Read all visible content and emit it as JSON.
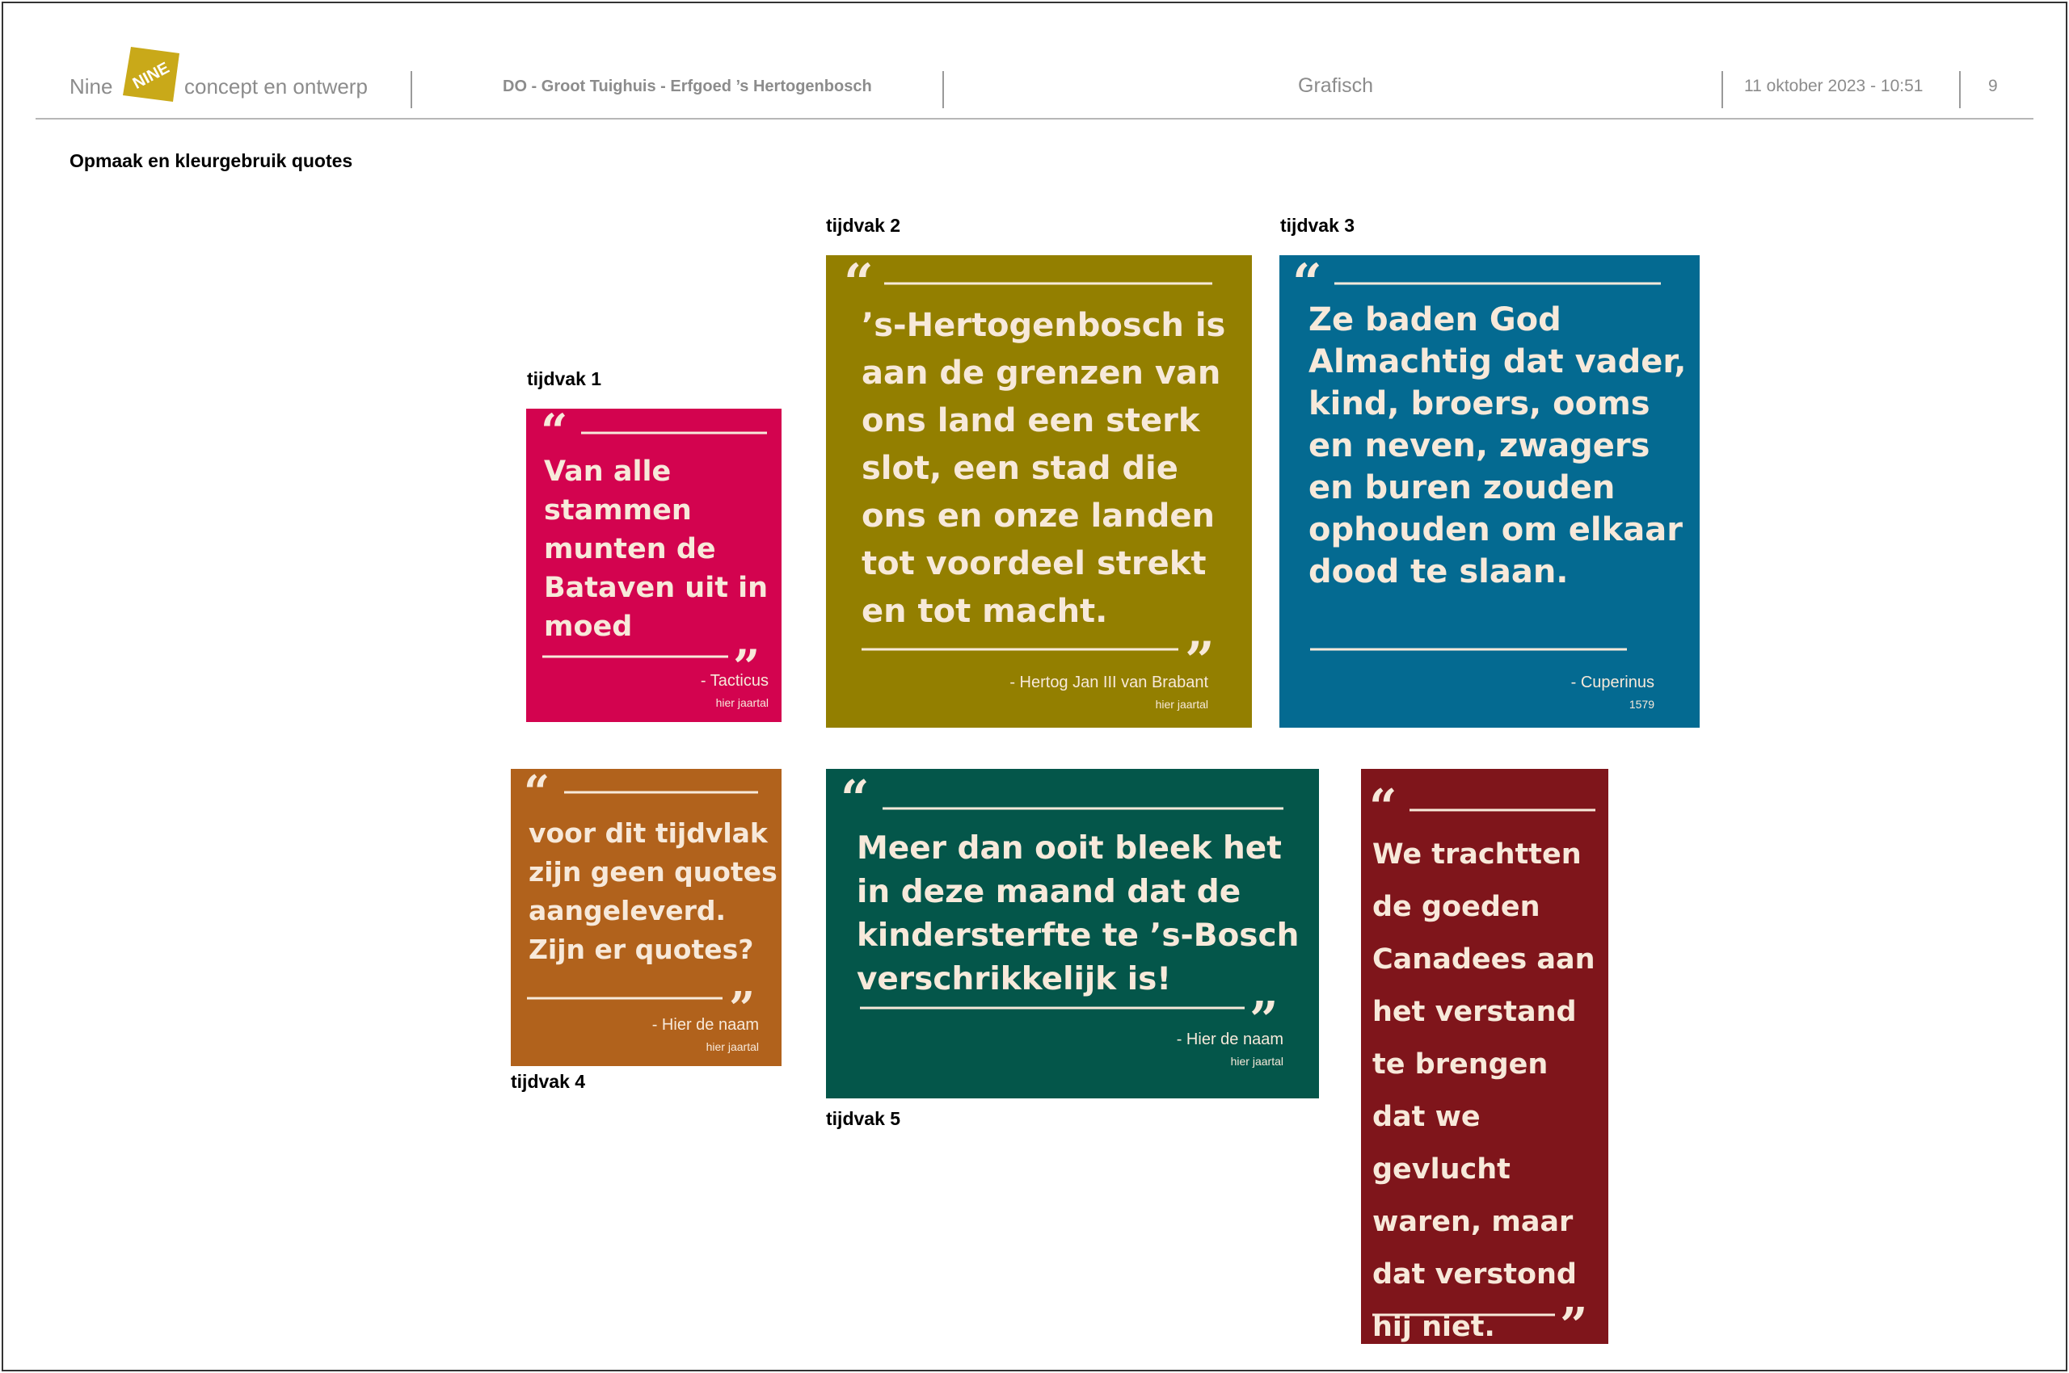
{
  "header": {
    "brand_name": "Nine",
    "logo_text": "NINE",
    "brand_tagline": "concept en ontwerp",
    "project": "DO - Groot Tuighuis - Erfgoed ’s Hertogenbosch",
    "section": "Grafisch",
    "date": "11  oktober  2023  -  10:51",
    "page_number": "9"
  },
  "page_title": "Opmaak en kleurgebruik quotes",
  "cards": [
    {
      "label": "tijdvak 1",
      "color": "#d3034f",
      "quote": "Van alle stammen munten de Bataven uit in moed",
      "author": "- Tacticus",
      "year": "hier jaartal"
    },
    {
      "label": "tijdvak 2",
      "color": "#937f00",
      "quote": "’s-Hertogenbosch is aan de grenzen van ons land een sterk slot, een stad die ons en onze landen tot voordeel strekt en tot macht.",
      "author": "- Hertog Jan III van Brabant",
      "year": "hier jaartal"
    },
    {
      "label": "tijdvak 3",
      "color": "#046a91",
      "quote": "Ze baden God Almachtig dat vader, kind, broers, ooms en neven, zwagers en buren zouden ophouden om elkaar dood te slaan.",
      "author": "- Cuperinus",
      "year": "1579"
    },
    {
      "label": "tijdvak 4",
      "color": "#b1621c",
      "quote": "voor dit tijdvlak zijn geen quotes aangeleverd. Zijn er quotes?",
      "author": "- Hier de naam",
      "year": "hier jaartal"
    },
    {
      "label": "tijdvak 5",
      "color": "#04564a",
      "quote": "Meer dan ooit bleek het in deze maand dat de kindersterfte te ’s-Bosch verschrikkelijk is!",
      "author": "- Hier de naam",
      "year": "hier jaartal"
    },
    {
      "label": "",
      "color": "#7f151b",
      "quote": "We trachtten de goeden Canadees aan het verstand te brengen dat we gevlucht waren, maar dat verstond hij niet.",
      "author": "",
      "year": ""
    }
  ]
}
